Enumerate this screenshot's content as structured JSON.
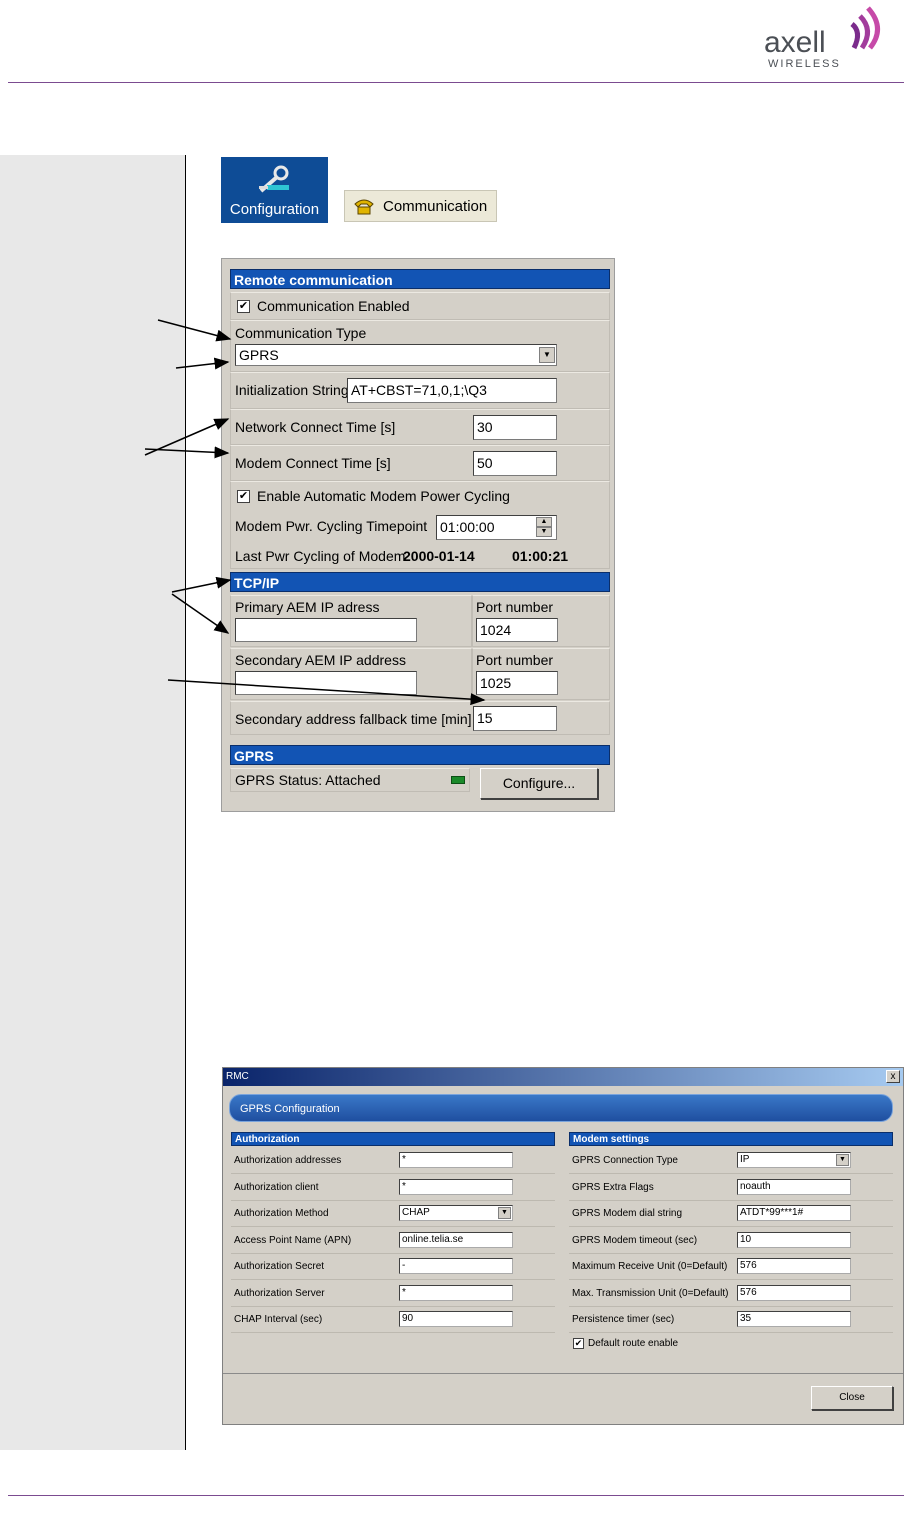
{
  "header": {
    "logo_text": "axell",
    "logo_subtext": "WIRELESS",
    "brand_color": "#7b4b90"
  },
  "toolbar": {
    "configuration_label": "Configuration",
    "communication_label": "Communication"
  },
  "remote_panel": {
    "section_title": "Remote communication",
    "communication_enabled_label": "Communication Enabled",
    "communication_enabled_checked": true,
    "communication_type_label": "Communication Type",
    "communication_type_value": "GPRS",
    "init_string_label": "Initialization String",
    "init_string_value": "AT+CBST=71,0,1;\\Q3",
    "network_connect_label": "Network Connect Time [s]",
    "network_connect_value": "30",
    "modem_connect_label": "Modem Connect Time [s]",
    "modem_connect_value": "50",
    "auto_power_cycling_label": "Enable Automatic Modem Power Cycling",
    "auto_power_cycling_checked": true,
    "cycling_timepoint_label": "Modem Pwr. Cycling Timepoint",
    "cycling_timepoint_value": "01:00:00",
    "last_cycling_label": "Last Pwr Cycling of Modem",
    "last_cycling_date": "2000-01-14",
    "last_cycling_time": "01:00:21"
  },
  "tcpip_panel": {
    "section_title": "TCP/IP",
    "primary_ip_label": "Primary AEM IP adress",
    "primary_ip_value": "",
    "primary_port_label": "Port number",
    "primary_port_value": "1024",
    "secondary_ip_label": "Secondary AEM IP address",
    "secondary_ip_value": "",
    "secondary_port_label": "Port number",
    "secondary_port_value": "1025",
    "fallback_label": "Secondary address fallback time [min]",
    "fallback_value": "15"
  },
  "gprs_panel": {
    "section_title": "GPRS",
    "status_text": "GPRS Status: Attached",
    "status_led_color": "#1a8a2a",
    "configure_button": "Configure..."
  },
  "dialog": {
    "window_title": "RMC",
    "close_x": "x",
    "band_title": "GPRS Configuration",
    "authorization": {
      "title": "Authorization",
      "rows": [
        {
          "label": "Authorization addresses",
          "value": "*"
        },
        {
          "label": "Authorization client",
          "value": "*"
        },
        {
          "label": "Authorization Method",
          "value": "CHAP"
        },
        {
          "label": "Access Point Name (APN)",
          "value": "online.telia.se"
        },
        {
          "label": "Authorization Secret",
          "value": "-"
        },
        {
          "label": "Authorization Server",
          "value": "*"
        },
        {
          "label": "CHAP Interval (sec)",
          "value": "90"
        }
      ]
    },
    "modem": {
      "title": "Modem settings",
      "rows": [
        {
          "label": "GPRS Connection Type",
          "value": "IP"
        },
        {
          "label": "GPRS Extra Flags",
          "value": "noauth"
        },
        {
          "label": "GPRS Modem dial string",
          "value": "ATDT*99***1#"
        },
        {
          "label": "GPRS Modem timeout (sec)",
          "value": "10"
        },
        {
          "label": "Maximum Receive Unit (0=Default)",
          "value": "576"
        },
        {
          "label": "Max. Transmission Unit (0=Default)",
          "value": "576"
        },
        {
          "label": "Persistence timer (sec)",
          "value": "35"
        }
      ],
      "default_route_label": "Default route enable",
      "default_route_checked": true
    },
    "close_button": "Close"
  }
}
